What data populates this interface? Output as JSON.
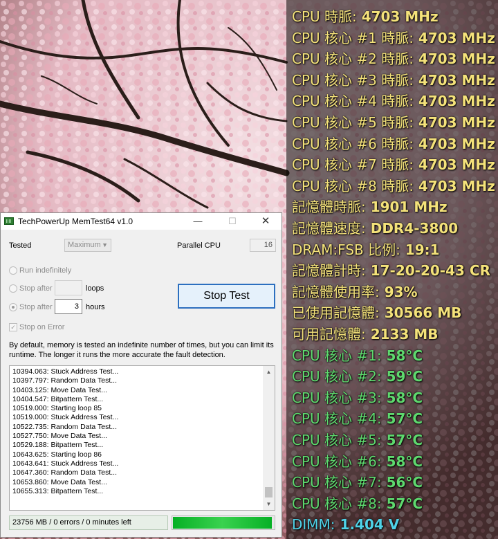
{
  "stats_panel": {
    "colors": {
      "yellow": "#f4e27a",
      "green": "#5ed96e",
      "cyan": "#4fd3e8"
    },
    "lines": [
      {
        "label": "CPU 時脈:",
        "value": " 4703 MHz",
        "color": "#f4e27a"
      },
      {
        "label": "CPU 核心 #1 時脈:",
        "value": " 4703 MHz",
        "color": "#f4e27a"
      },
      {
        "label": "CPU 核心 #2 時脈:",
        "value": " 4703 MHz",
        "color": "#f4e27a"
      },
      {
        "label": "CPU 核心 #3 時脈:",
        "value": " 4703 MHz",
        "color": "#f4e27a"
      },
      {
        "label": "CPU 核心 #4 時脈:",
        "value": " 4703 MHz",
        "color": "#f4e27a"
      },
      {
        "label": "CPU 核心 #5 時脈:",
        "value": " 4703 MHz",
        "color": "#f4e27a"
      },
      {
        "label": "CPU 核心 #6 時脈:",
        "value": " 4703 MHz",
        "color": "#f4e27a"
      },
      {
        "label": "CPU 核心 #7 時脈:",
        "value": " 4703 MHz",
        "color": "#f4e27a"
      },
      {
        "label": "CPU 核心 #8 時脈:",
        "value": " 4703 MHz",
        "color": "#f4e27a"
      },
      {
        "label": "記憶體時脈:",
        "value": " 1901 MHz",
        "color": "#f4e27a"
      },
      {
        "label": "記憶體速度:",
        "value": " DDR4-3800",
        "color": "#f4e27a"
      },
      {
        "label": "DRAM:FSB 比例:",
        "value": " 19:1",
        "color": "#f4e27a"
      },
      {
        "label": "記憶體計時:",
        "value": " 17-20-20-43 CR",
        "color": "#f4e27a"
      },
      {
        "label": "記憶體使用率:",
        "value": " 93%",
        "color": "#f4e27a"
      },
      {
        "label": "已使用記憶體:",
        "value": " 30566 MB",
        "color": "#f4e27a"
      },
      {
        "label": "可用記憶體:",
        "value": " 2133 MB",
        "color": "#f4e27a"
      },
      {
        "label": "CPU 核心 #1:",
        "value": " 58°C",
        "color": "#5ed96e"
      },
      {
        "label": "CPU 核心 #2:",
        "value": " 59°C",
        "color": "#5ed96e"
      },
      {
        "label": "CPU 核心 #3:",
        "value": " 58°C",
        "color": "#5ed96e"
      },
      {
        "label": "CPU 核心 #4:",
        "value": " 57°C",
        "color": "#5ed96e"
      },
      {
        "label": "CPU 核心 #5:",
        "value": " 57°C",
        "color": "#5ed96e"
      },
      {
        "label": "CPU 核心 #6:",
        "value": " 58°C",
        "color": "#5ed96e"
      },
      {
        "label": "CPU 核心 #7:",
        "value": " 56°C",
        "color": "#5ed96e"
      },
      {
        "label": "CPU 核心 #8:",
        "value": " 57°C",
        "color": "#5ed96e"
      },
      {
        "label": "DIMM:",
        "value": " 1.404 V",
        "color": "#4fd3e8"
      }
    ]
  },
  "window": {
    "title": "TechPowerUp MemTest64 v1.0",
    "icon": "memory-chip-icon",
    "controls": {
      "minimize": "—",
      "maximize": "☐",
      "close": "✕"
    },
    "tested_label": "Tested",
    "tested_value": "Maximum",
    "parallel_cpu_label": "Parallel CPU",
    "parallel_cpu_value": "16",
    "run_indefinitely_label": "Run indefinitely",
    "stop_after_loops_label": "Stop after",
    "loops_unit": "loops",
    "stop_after_hours_label": "Stop after",
    "hours_value": "3",
    "hours_unit": "hours",
    "stop_on_error_label": "Stop on Error",
    "stop_button": "Stop Test",
    "description": "By default, memory is tested an indefinite number of times, but you can limit its runtime. The longer it runs the more accurate the fault detection.",
    "log": [
      "10394.063: Stuck Address Test...",
      "10397.797: Random Data Test...",
      "10403.125: Move Data Test...",
      "10404.547: Bitpattern Test...",
      "10519.000: Starting loop 85",
      "10519.000: Stuck Address Test...",
      "10522.735: Random Data Test...",
      "10527.750: Move Data Test...",
      "10529.188: Bitpattern Test...",
      "10643.625: Starting loop 86",
      "10643.641: Stuck Address Test...",
      "10647.360: Random Data Test...",
      "10653.860: Move Data Test...",
      "10655.313: Bitpattern Test..."
    ],
    "status": "23756 MB / 0 errors / 0 minutes left",
    "progress_fraction": 0.98,
    "progress_color": "#06b025"
  }
}
